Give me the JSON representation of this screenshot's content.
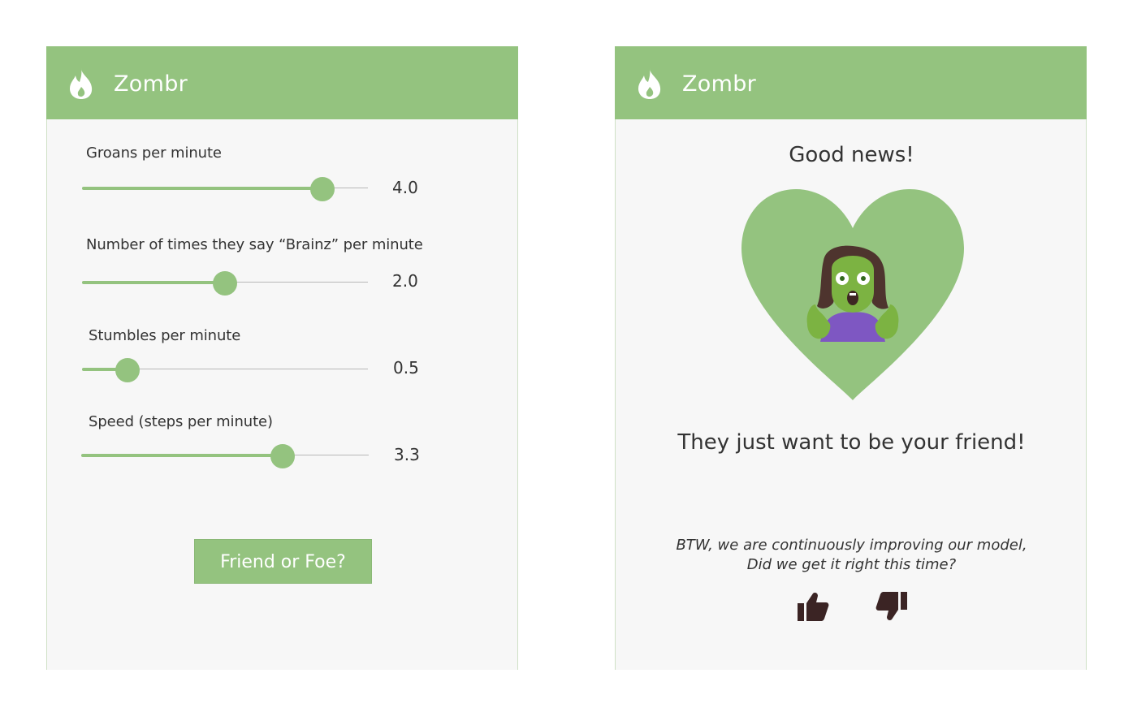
{
  "colors": {
    "brand": "#94c37f",
    "panel_bg": "#f7f7f7",
    "text": "#333333",
    "thumb": "#3b2424",
    "zombie_skin": "#7cb342",
    "zombie_hair": "#4e342e",
    "zombie_shirt": "#7e57c2"
  },
  "left_panel": {
    "app_title": "Zombr",
    "app_icon": "flame-icon",
    "sliders": [
      {
        "label": "Groans per minute",
        "value_text": "4.0",
        "fraction": 0.84
      },
      {
        "label": "Number of times they say “Brainz” per minute",
        "value_text": "2.0",
        "fraction": 0.5
      },
      {
        "label": "Stumbles per minute",
        "value_text": "0.5",
        "fraction": 0.16
      },
      {
        "label": "Speed (steps per minute)",
        "value_text": "3.3",
        "fraction": 0.7
      }
    ],
    "submit_label": "Friend or Foe?"
  },
  "right_panel": {
    "app_title": "Zombr",
    "app_icon": "flame-icon",
    "headline": "Good news!",
    "result_text": "They just want to be your friend!",
    "illustration": "zombie-in-heart",
    "feedback_line1": "BTW, we are continuously improving our model,",
    "feedback_line2": "Did we get it right this time?",
    "thumbs_up_icon": "thumbs-up-icon",
    "thumbs_down_icon": "thumbs-down-icon"
  }
}
